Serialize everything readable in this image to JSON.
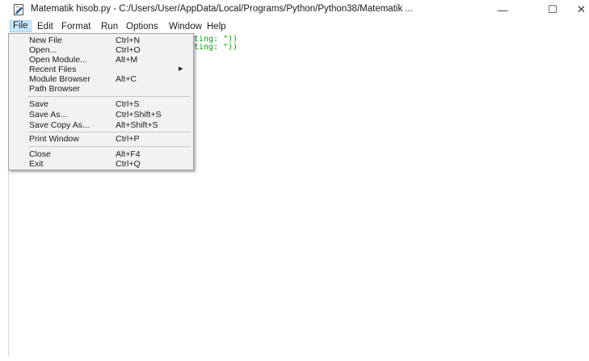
{
  "window": {
    "title": "Matematik hisob.py - C:/Users/User/AppData/Local/Programs/Python/Python38/Matematik ...",
    "minimize_glyph": "—",
    "maximize_glyph": "☐",
    "close_glyph": "✕"
  },
  "menubar": {
    "items": [
      {
        "label": "File",
        "active": true
      },
      {
        "label": "Edit"
      },
      {
        "label": "Format"
      },
      {
        "label": "Run"
      },
      {
        "label": "Options"
      },
      {
        "label": "Window"
      },
      {
        "label": "Help"
      }
    ]
  },
  "editor": {
    "line1_visible": "ting: \"))",
    "line2_visible": "ting: \"))",
    "string_color": "#00aa00"
  },
  "file_menu": {
    "groups": [
      [
        {
          "label": "New File",
          "shortcut": "Ctrl+N"
        },
        {
          "label": "Open...",
          "shortcut": "Ctrl+O"
        },
        {
          "label": "Open Module...",
          "shortcut": "Alt+M"
        },
        {
          "label": "Recent Files",
          "shortcut": "",
          "submenu": true
        },
        {
          "label": "Module Browser",
          "shortcut": "Alt+C"
        },
        {
          "label": "Path Browser",
          "shortcut": ""
        }
      ],
      [
        {
          "label": "Save",
          "shortcut": "Ctrl+S"
        },
        {
          "label": "Save As...",
          "shortcut": "Ctrl+Shift+S"
        },
        {
          "label": "Save Copy As...",
          "shortcut": "Alt+Shift+S"
        }
      ],
      [
        {
          "label": "Print Window",
          "shortcut": "Ctrl+P"
        }
      ],
      [
        {
          "label": "Close",
          "shortcut": "Alt+F4"
        },
        {
          "label": "Exit",
          "shortcut": "Ctrl+Q"
        }
      ]
    ],
    "submenu_arrow": "▶"
  }
}
